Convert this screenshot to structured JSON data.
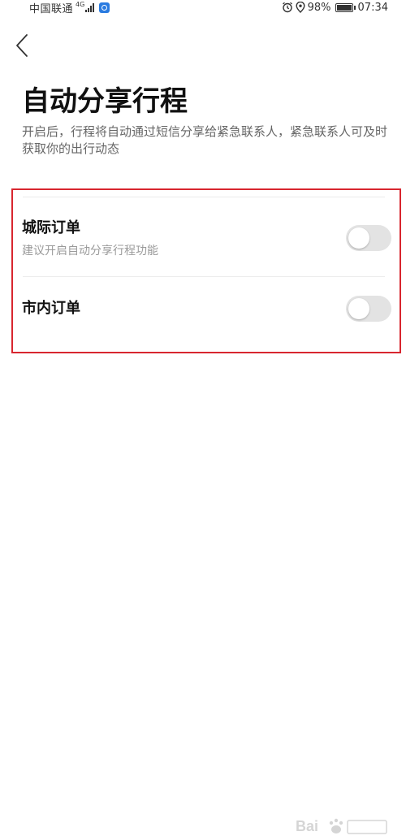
{
  "status_bar": {
    "carrier": "中国联通",
    "network_type": "4G",
    "battery_percent": "98%",
    "time": "07:34"
  },
  "header": {
    "title": "自动分享行程",
    "description": "开启后，行程将自动通过短信分享给紧急联系人，紧急联系人可及时获取你的出行动态"
  },
  "settings": [
    {
      "label": "城际订单",
      "sublabel": "建议开启自动分享行程功能",
      "enabled": false
    },
    {
      "label": "市内订单",
      "sublabel": "",
      "enabled": false
    }
  ],
  "colors": {
    "highlight_border": "#d8262f",
    "toggle_off": "#e3e3e3",
    "app_badge": "#2a7be0"
  },
  "icons": [
    "back-chevron-icon",
    "signal-icon",
    "alarm-icon",
    "location-icon",
    "battery-icon"
  ]
}
